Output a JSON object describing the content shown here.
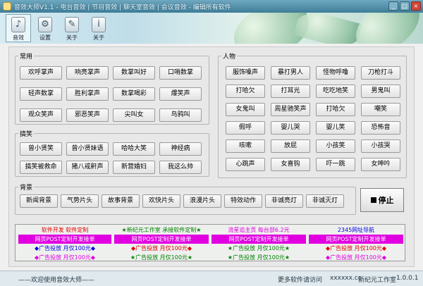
{
  "window": {
    "title": "音效大师V1.1  -  电台音效  |  节目音效  |  聊天室音效  |  会议音效  -  编辑所有软件",
    "buttons": {
      "minimize": "_",
      "maximize": "□",
      "close": "×"
    }
  },
  "toolbar": {
    "items": [
      {
        "label": "音效"
      },
      {
        "label": "设置"
      },
      {
        "label": "关于"
      },
      {
        "label": "关于"
      }
    ]
  },
  "groups": {
    "common": {
      "title": "常用",
      "buttons": [
        "欢呼掌声",
        "响亮掌声",
        "数掌叫好",
        "口哨数掌",
        "轻声数掌",
        "胜利掌声",
        "数掌喝彩",
        "爆笑声",
        "观众笑声",
        "邪恶笑声",
        "尖叫女",
        "鸟鸦叫"
      ]
    },
    "funny": {
      "title": "搞笑",
      "buttons": [
        "曾小贤笑",
        "曾小贤妹语",
        "哈哈大笑",
        "神经病",
        "搞笑被救命",
        "猪八戒鼾声",
        "新营婚妇",
        "我这么帅"
      ]
    },
    "background": {
      "title": "背景",
      "buttons": [
        "新闻背景",
        "气势片头",
        "故事背景",
        "欢快片头",
        "浪漫片头",
        "特效动作",
        "非诚亮灯",
        "非诚灭灯"
      ]
    },
    "people": {
      "title": "人物",
      "buttons": [
        "服饰嗓声",
        "暴打男人",
        "怪物呼噜",
        "刀枪打斗",
        "打哈欠",
        "打耳光",
        "吃吃地笑",
        "男鬼叫",
        "女鬼叫",
        "周星驰笑声",
        "打哈欠",
        "嘲笑",
        "假呼",
        "婴儿哭",
        "婴儿笑",
        "恐怖音",
        "咳嗽",
        "放屁",
        "小孩笑",
        "小孩哭",
        "心跳声",
        "女喜钩",
        "吓一跳",
        "女呻吟"
      ]
    }
  },
  "stop_button": {
    "label": "停止"
  },
  "ads": {
    "rows": [
      [
        "软件开发  软件定制",
        "★新纪元工作室 承接软件定制★",
        "流星追主页 每台部6.2元",
        "2345网址导航"
      ],
      [
        "网页POST定制开发接单",
        "网页POST定制开发接单",
        "网页POST定制开发接单",
        "网页POST定制开发接单"
      ],
      [
        "◆广告投放  月仅100元◆",
        "◆广告投放  月仅100元◆",
        "★广告投放  月仅100元★",
        "◆广告投放  月仅100元◆"
      ],
      [
        "◆广告投放  月仅100元◆",
        "★广告投放  月仅100元★",
        "★广告投放  月仅100元★",
        "◆广告投放  月仅100元◆"
      ]
    ],
    "colors": {
      "red": "#e00000",
      "green": "#008000",
      "blue": "#0000e0",
      "magenta": "#e000e0"
    }
  },
  "status": {
    "left": "——欢迎使用音效大师——",
    "center": "更多软件请访问",
    "url": "xxxxxx.cc",
    "right": "新纪元工作室",
    "version": "1.0.0.1"
  }
}
